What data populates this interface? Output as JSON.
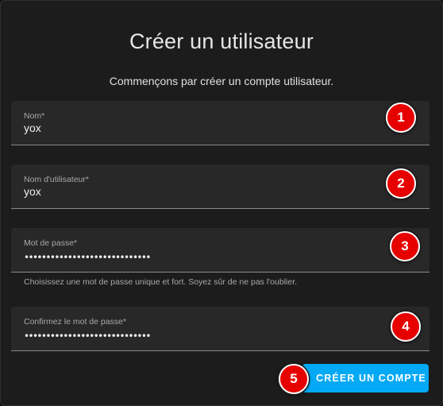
{
  "dialog": {
    "title": "Créer un utilisateur",
    "subtitle": "Commençons par créer un compte utilisateur."
  },
  "fields": {
    "name": {
      "label": "Nom*",
      "value": "yox"
    },
    "username": {
      "label": "Nom d'utilisateur*",
      "value": "yox"
    },
    "password": {
      "label": "Mot de passe*",
      "value": "•••••••••••••••••••••••••••••",
      "helper": "Choisissez une mot de passe unique et fort. Soyez sûr de ne pas l'oublier."
    },
    "confirm_password": {
      "label": "Confirmez le mot de passe*",
      "value": "•••••••••••••••••••••••••••••"
    }
  },
  "actions": {
    "create_label": "CRÉER UN COMPTE"
  },
  "badges": [
    "1",
    "2",
    "3",
    "4",
    "5"
  ],
  "colors": {
    "accent": "#03a9f4",
    "badge": "#e60000",
    "background": "#1c1c1c",
    "field_bg": "#282828"
  }
}
